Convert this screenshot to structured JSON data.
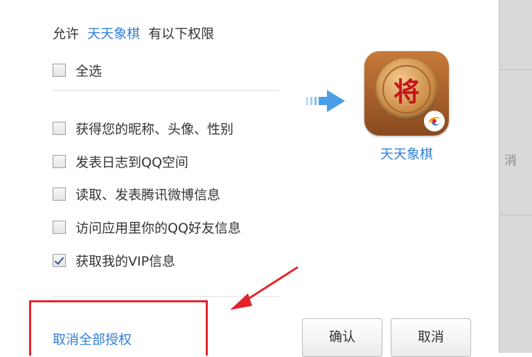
{
  "header": {
    "allow_prefix": "允许",
    "app_name": "天天象棋",
    "allow_suffix": "有以下权限"
  },
  "select_all": {
    "label": "全选",
    "checked": false
  },
  "permissions": [
    {
      "label": "获得您的昵称、头像、性别",
      "checked": false
    },
    {
      "label": "发表日志到QQ空间",
      "checked": false
    },
    {
      "label": "读取、发表腾讯微博信息",
      "checked": false
    },
    {
      "label": "访问应用里你的QQ好友信息",
      "checked": false
    },
    {
      "label": "获取我的VIP信息",
      "checked": true
    }
  ],
  "app": {
    "name": "天天象棋",
    "icon_char": "将",
    "icon": "chinese-chess-icon",
    "badge_icon": "tencent-games-logo-icon"
  },
  "footer": {
    "cancel_all_label": "取消全部授权",
    "confirm_label": "确认",
    "cancel_label": "取消"
  },
  "background_fragment": "消",
  "colors": {
    "link": "#2f7fd8",
    "highlight": "#e5232a",
    "arrow_blue": "#4a9ee6"
  }
}
